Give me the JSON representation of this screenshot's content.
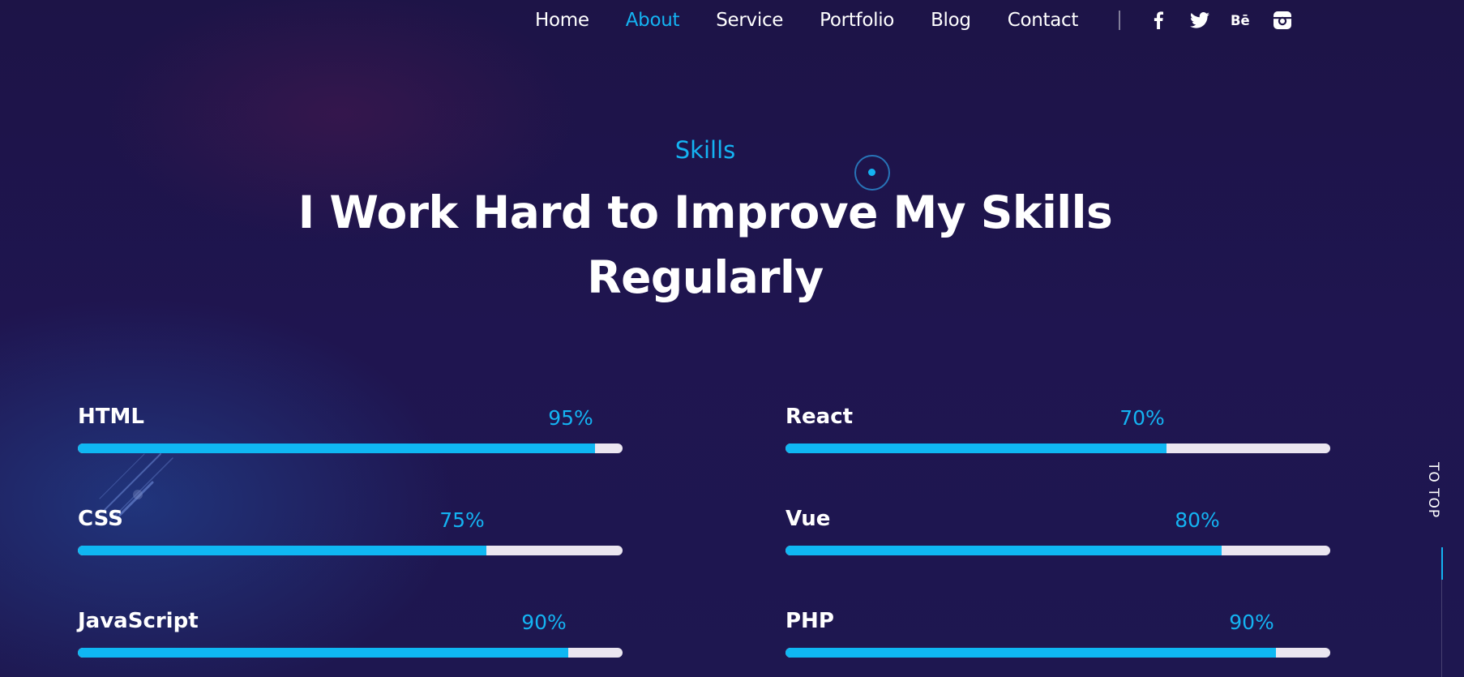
{
  "nav": {
    "items": [
      {
        "label": "Home",
        "active": false
      },
      {
        "label": "About",
        "active": true
      },
      {
        "label": "Service",
        "active": false
      },
      {
        "label": "Portfolio",
        "active": false
      },
      {
        "label": "Blog",
        "active": false
      },
      {
        "label": "Contact",
        "active": false
      }
    ],
    "social": [
      "facebook-icon",
      "twitter-icon",
      "behance-icon",
      "instagram-icon"
    ]
  },
  "section": {
    "eyebrow": "Skills",
    "title_line1": "I Work Hard to Improve My Skills",
    "title_line2": "Regularly"
  },
  "skills": [
    {
      "name": "HTML",
      "percent_label": "95%",
      "value": 95
    },
    {
      "name": "React",
      "percent_label": "70%",
      "value": 70
    },
    {
      "name": "CSS",
      "percent_label": "75%",
      "value": 75
    },
    {
      "name": "Vue",
      "percent_label": "80%",
      "value": 80
    },
    {
      "name": "JavaScript",
      "percent_label": "90%",
      "value": 90
    },
    {
      "name": "PHP",
      "percent_label": "90%",
      "value": 90
    }
  ],
  "to_top": {
    "label": "TO TOP"
  },
  "colors": {
    "accent": "#14b3f2",
    "background": "#1e1548",
    "track": "#ebe6f0"
  }
}
